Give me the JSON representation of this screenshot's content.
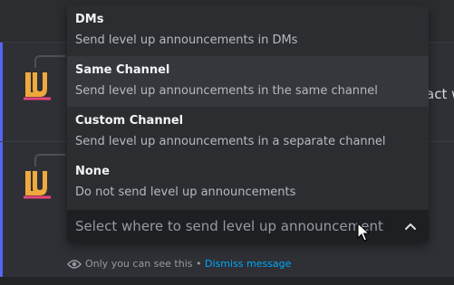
{
  "dropdown": {
    "options": [
      {
        "label": "DMs",
        "description": "Send level up announcements in DMs"
      },
      {
        "label": "Same Channel",
        "description": "Send level up announcements in the same channel"
      },
      {
        "label": "Custom Channel",
        "description": "Send level up announcements in a separate channel"
      },
      {
        "label": "None",
        "description": "Do not send level up announcements"
      }
    ],
    "placeholder": "Select where to send level up announcement"
  },
  "background": {
    "clipped_text": "act w"
  },
  "footer": {
    "ephemeral_note": "Only you can see this",
    "separator": "•",
    "dismiss_label": "Dismiss message"
  },
  "colors": {
    "accent": "#5865f2",
    "link": "#00a8fc",
    "logo_orange": "#f0a93c",
    "logo_pink": "#e8457a"
  },
  "icons": {
    "avatar": "lu-logo-icon",
    "chevron": "chevron-up-icon",
    "eye": "eye-icon",
    "cursor": "mouse-cursor-icon"
  }
}
